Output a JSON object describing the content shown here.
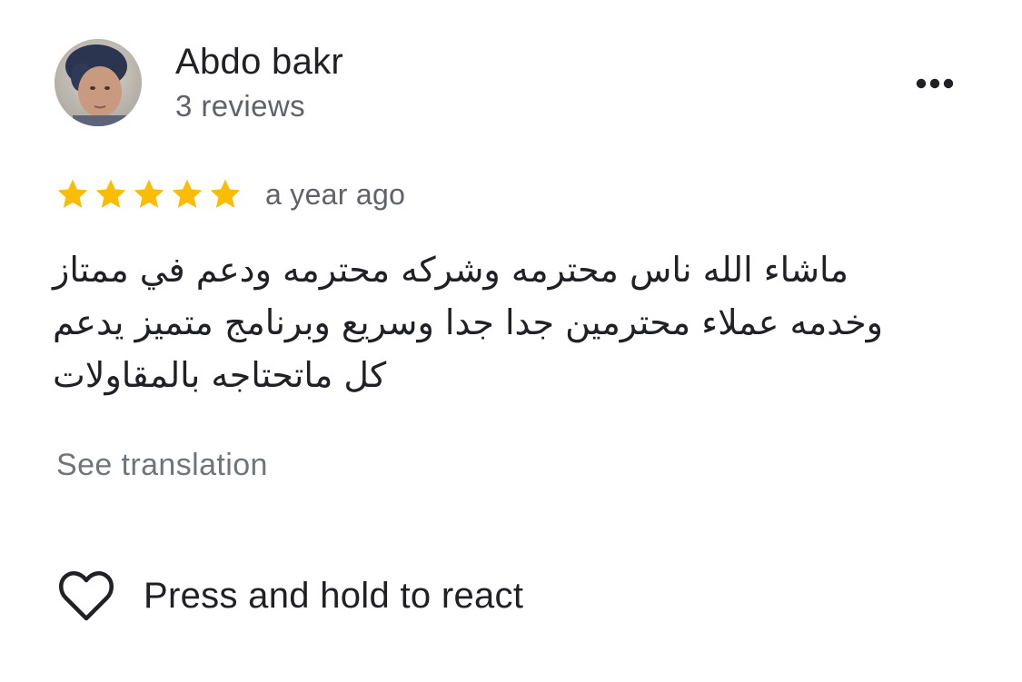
{
  "review": {
    "author": {
      "name": "Abdo bakr",
      "review_count": "3 reviews",
      "avatar_icon": "profile-photo"
    },
    "more_icon": "more-horizontal-icon",
    "rating": {
      "stars": 5,
      "max": 5,
      "star_color": "#FBBC04",
      "time_ago": "a year ago"
    },
    "text_lines": [
      "ماشاء الله ناس محترمه وشركه محترمه ودعم في ممتاز",
      "وخدمه عملاء محترمين جدا جدا وسريع وبرنامج متميز يدعم",
      "كل ماتحتاجه بالمقاولات"
    ],
    "see_translation": "See translation",
    "react": {
      "icon": "heart-outline-icon",
      "label": "Press and hold to react"
    }
  }
}
